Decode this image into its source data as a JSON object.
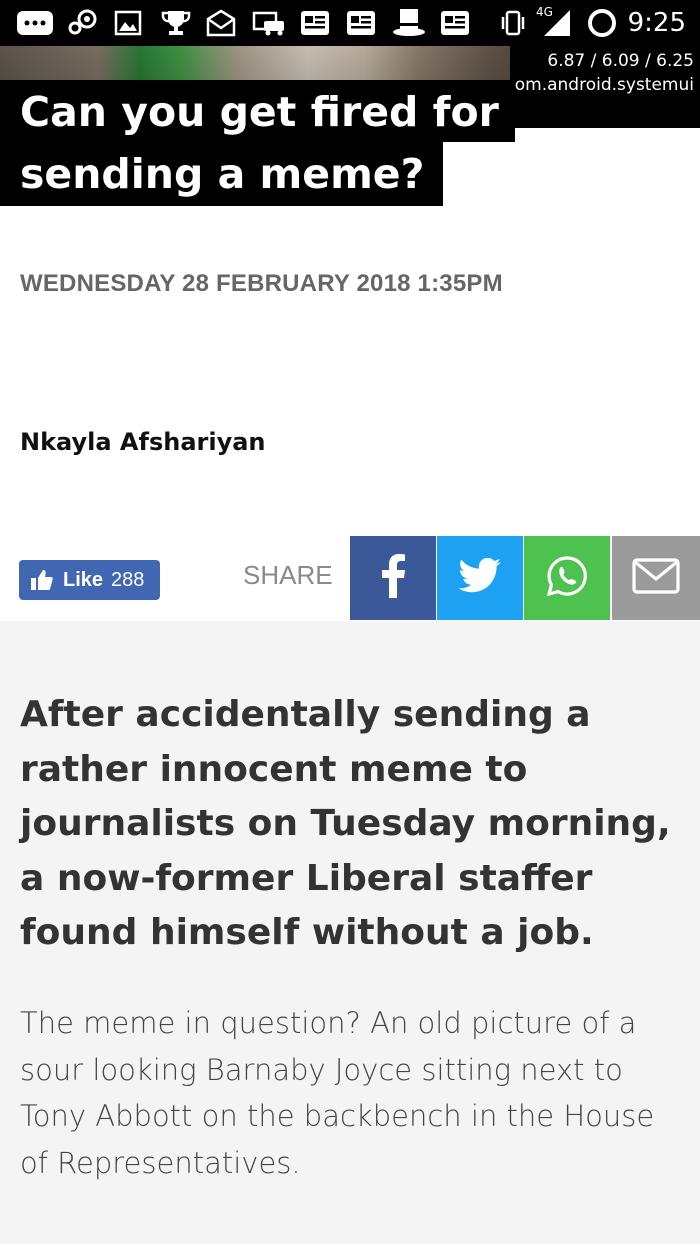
{
  "status_bar": {
    "time": "9:25",
    "network": "4G",
    "icons": [
      "more-icon",
      "steam-icon",
      "image-icon",
      "trophy-icon",
      "mail-icon",
      "car-icon",
      "news-icon",
      "news-icon",
      "top-hat-icon",
      "news-icon",
      "vibrate-icon",
      "signal-icon",
      "sync-icon"
    ]
  },
  "overlay": {
    "stats": "6.87 / 6.09 / 6.25",
    "package": "com.android.systemui"
  },
  "article": {
    "title_line1": "Can you get fired for",
    "title_line2": "sending a meme?",
    "date": "WEDNESDAY 28 FEBRUARY 2018 1:35PM",
    "author": "Nkayla Afshariyan",
    "lede": "After accidentally sending a rather innocent meme to journalists on Tuesday morning, a now-former Liberal staffer found himself without a job.",
    "paragraph": "The meme in question? An old picture of a sour looking Barnaby Joyce sitting next to Tony Abbott on the backbench in the House of Representatives."
  },
  "share": {
    "like_label": "Like",
    "like_count": "288",
    "share_label": "SHARE",
    "buttons": [
      "facebook-icon",
      "twitter-icon",
      "whatsapp-icon",
      "email-icon"
    ]
  },
  "colors": {
    "facebook": "#3b5998",
    "twitter": "#1da1f2",
    "whatsapp": "#4ec24e",
    "email": "#9b9b9b",
    "like": "#4267b2"
  }
}
